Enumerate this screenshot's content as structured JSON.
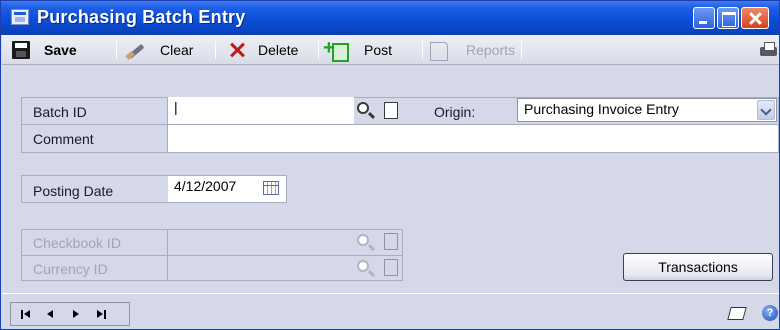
{
  "window": {
    "title": "Purchasing Batch Entry"
  },
  "toolbar": {
    "save": "Save",
    "clear": "Clear",
    "delete": "Delete",
    "post": "Post",
    "reports": "Reports"
  },
  "form": {
    "batch_id": {
      "label": "Batch ID",
      "value": "|"
    },
    "origin": {
      "label": "Origin:",
      "value": "Purchasing Invoice Entry"
    },
    "comment": {
      "label": "Comment",
      "value": ""
    },
    "posting_date": {
      "label": "Posting Date",
      "value": "4/12/2007"
    },
    "checkbook_id": {
      "label": "Checkbook ID",
      "value": ""
    },
    "currency_id": {
      "label": "Currency ID",
      "value": ""
    },
    "transactions_button": "Transactions"
  },
  "icons": {
    "title": "window-icon",
    "save": "save-icon",
    "clear": "eraser-icon",
    "delete": "delete-x-icon",
    "post": "post-icon",
    "reports": "reports-icon",
    "print": "printer-icon",
    "lookup": "magnifier-icon",
    "new": "new-document-icon",
    "calendar": "calendar-icon",
    "note": "note-icon",
    "help": "help-icon"
  }
}
